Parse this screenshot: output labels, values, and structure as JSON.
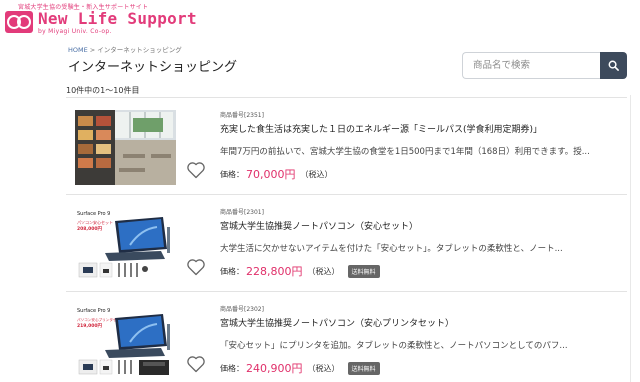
{
  "header": {
    "tagline": "宮城大学生協の受験生・新入生サポートサイト",
    "title": "New Life Support",
    "subtitle": "by Miyagi Univ. Co-op."
  },
  "breadcrumb": {
    "home": "HOME",
    "separator": ">",
    "current": "インターネットショッピング"
  },
  "page": {
    "title": "インターネットショッピング",
    "result_count": "10件中の1～10件目"
  },
  "search": {
    "placeholder": "商品名で検索"
  },
  "colors": {
    "brand": "#e23b7a",
    "price": "#e0306a",
    "search_button": "#3d4a5c"
  },
  "products": [
    {
      "id": "商品番号[2351]",
      "name": "充実した食生活は充実した１日のエネルギー源「ミールパス(学食利用定期券)」",
      "description": "年間7万円の前払いで、宮城大学生協の食堂を1日500円まで1年間（168日）利用できます。授...",
      "price_label": "価格：",
      "price": "70,000円",
      "tax": "（税込）",
      "badge": ""
    },
    {
      "id": "商品番号[2301]",
      "name": "宮城大学生協推奨ノートパソコン（安心セット）",
      "description": "大学生活に欠かせないアイテムを付けた「安心セット」。タブレットの柔軟性と、ノート...",
      "price_label": "価格：",
      "price": "228,800円",
      "tax": "（税込）",
      "badge": "送料無料",
      "image_text": {
        "brand": "Surface Pro 9",
        "set_name": "パソコン安心セット",
        "set_price": "208,000円"
      }
    },
    {
      "id": "商品番号[2302]",
      "name": "宮城大学生協推奨ノートパソコン（安心プリンタセット）",
      "description": "「安心セット」にプリンタを追加。タブレットの柔軟性と、ノートパソコンとしてのパフ...",
      "price_label": "価格：",
      "price": "240,900円",
      "tax": "（税込）",
      "badge": "送料無料",
      "image_text": {
        "brand": "Surface Pro 9",
        "set_name": "パソコン安心プリンタセット",
        "set_price": "219,000円"
      }
    }
  ]
}
